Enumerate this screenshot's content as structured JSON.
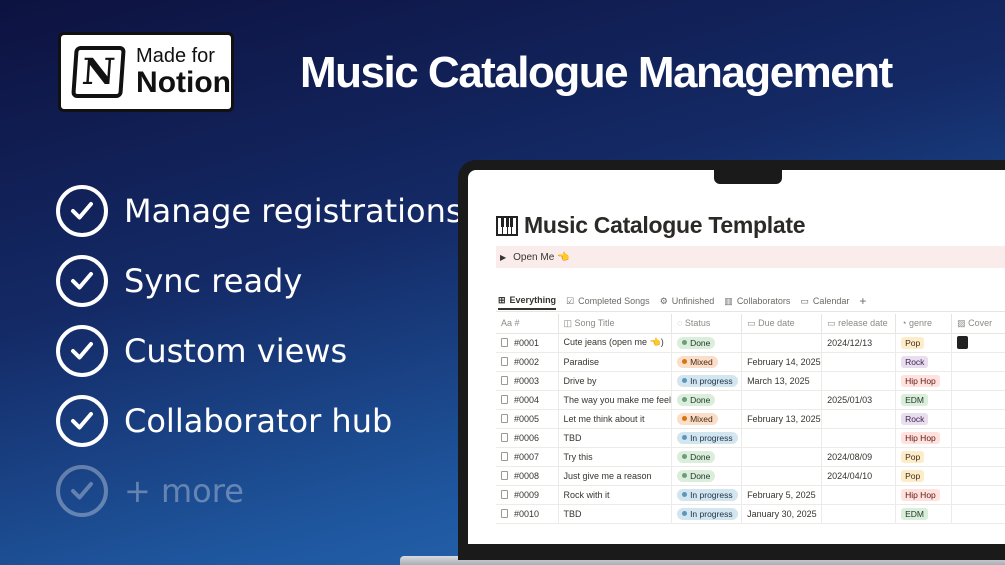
{
  "badge": {
    "line1": "Made for",
    "line2": "Notion",
    "logo_letter": "N"
  },
  "headline": "Music Catalogue Management",
  "features": [
    {
      "label": "Manage registrations",
      "dim": false
    },
    {
      "label": "Sync ready",
      "dim": false
    },
    {
      "label": "Custom views",
      "dim": false
    },
    {
      "label": "Collaborator hub",
      "dim": false
    },
    {
      "label": "+ more",
      "dim": true
    }
  ],
  "notion": {
    "page_title": "Music Catalogue Template",
    "callout": "Open Me 👈",
    "tabs": [
      {
        "label": "Everything",
        "icon": "⊞",
        "active": true
      },
      {
        "label": "Completed Songs",
        "icon": "☑",
        "active": false
      },
      {
        "label": "Unfinished",
        "icon": "⚙",
        "active": false
      },
      {
        "label": "Collaborators",
        "icon": "▥",
        "active": false
      },
      {
        "label": "Calendar",
        "icon": "▭",
        "active": false
      }
    ],
    "add_view": "+",
    "columns": [
      "Aa #",
      "Song Title",
      "Status",
      "Due date",
      "release date",
      "genre",
      "Cover"
    ],
    "rows": [
      {
        "id": "#0001",
        "title": "Cute jeans (open me 👈)",
        "status": "Done",
        "due": "",
        "release": "2024/12/13",
        "genre": "Pop",
        "cover": true
      },
      {
        "id": "#0002",
        "title": "Paradise",
        "status": "Mixed",
        "due": "February 14, 2025",
        "release": "",
        "genre": "Rock",
        "cover": false
      },
      {
        "id": "#0003",
        "title": "Drive by",
        "status": "In progress",
        "due": "March 13, 2025",
        "release": "",
        "genre": "Hip Hop",
        "cover": false
      },
      {
        "id": "#0004",
        "title": "The way you make me feel",
        "status": "Done",
        "due": "",
        "release": "2025/01/03",
        "genre": "EDM",
        "cover": false
      },
      {
        "id": "#0005",
        "title": "Let me think about it",
        "status": "Mixed",
        "due": "February 13, 2025",
        "release": "",
        "genre": "Rock",
        "cover": false
      },
      {
        "id": "#0006",
        "title": "TBD",
        "status": "In progress",
        "due": "",
        "release": "",
        "genre": "Hip Hop",
        "cover": false
      },
      {
        "id": "#0007",
        "title": "Try this",
        "status": "Done",
        "due": "",
        "release": "2024/08/09",
        "genre": "Pop",
        "cover": false
      },
      {
        "id": "#0008",
        "title": "Just give me a reason",
        "status": "Done",
        "due": "",
        "release": "2024/04/10",
        "genre": "Pop",
        "cover": false
      },
      {
        "id": "#0009",
        "title": "Rock with it",
        "status": "In progress",
        "due": "February 5, 2025",
        "release": "",
        "genre": "Hip Hop",
        "cover": false
      },
      {
        "id": "#0010",
        "title": "TBD",
        "status": "In progress",
        "due": "January 30, 2025",
        "release": "",
        "genre": "EDM",
        "cover": false
      }
    ]
  },
  "colors": {
    "status": {
      "Done": {
        "bg": "#dbeddb",
        "fg": "#1c3829",
        "dot": "#6c9b7d"
      },
      "Mixed": {
        "bg": "#fadec9",
        "fg": "#49290e",
        "dot": "#d9730d"
      },
      "In progress": {
        "bg": "#d3e5ef",
        "fg": "#183347",
        "dot": "#5b97bd"
      }
    },
    "genre": {
      "Pop": {
        "bg": "#fdecc8",
        "fg": "#402c1b"
      },
      "Rock": {
        "bg": "#e8deee",
        "fg": "#412454"
      },
      "Hip Hop": {
        "bg": "#ffe2dd",
        "fg": "#5d1715"
      },
      "EDM": {
        "bg": "#dbeddb",
        "fg": "#1c3829"
      }
    }
  }
}
